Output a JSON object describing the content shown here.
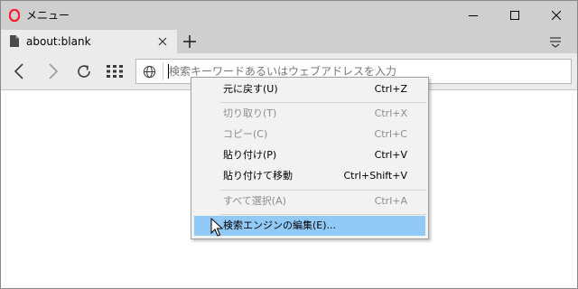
{
  "window": {
    "title": "メニュー",
    "controls": {
      "minimize": "minimize",
      "maximize": "maximize",
      "close": "close"
    }
  },
  "tabs": [
    {
      "title": "about:blank",
      "active": true
    }
  ],
  "address_bar": {
    "value": "",
    "placeholder": "検索キーワードあるいはウェブアドレスを入力"
  },
  "context_menu": {
    "items": [
      {
        "label": "元に戻す(U)",
        "shortcut": "Ctrl+Z",
        "enabled": true
      },
      {
        "label": "切り取り(T)",
        "shortcut": "Ctrl+X",
        "enabled": false
      },
      {
        "label": "コピー(C)",
        "shortcut": "Ctrl+C",
        "enabled": false
      },
      {
        "label": "貼り付け(P)",
        "shortcut": "Ctrl+V",
        "enabled": true
      },
      {
        "label": "貼り付けて移動",
        "shortcut": "Ctrl+Shift+V",
        "enabled": true
      },
      {
        "label": "すべて選択(A)",
        "shortcut": "Ctrl+A",
        "enabled": false
      },
      {
        "label": "検索エンジンの編集(E)...",
        "shortcut": "",
        "enabled": true,
        "highlighted": true
      }
    ]
  },
  "colors": {
    "titlebar": "#cfcfcf",
    "toolbar": "#ebebeb",
    "highlight": "#91c9f7",
    "opera_red": "#ff1b2d"
  },
  "icons": {
    "logo": "opera-logo-icon",
    "back": "back-arrow-icon",
    "forward": "forward-arrow-icon",
    "reload": "reload-icon",
    "speed_dial": "speed-dial-grid-icon",
    "globe": "globe-icon",
    "tab_menu": "tab-menu-icon"
  }
}
